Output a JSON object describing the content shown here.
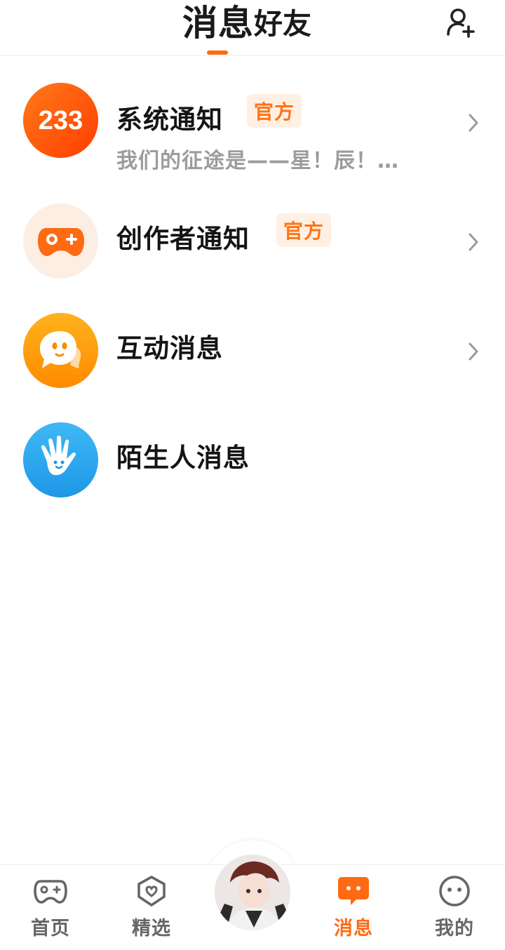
{
  "header": {
    "tabs": [
      {
        "label": "消息",
        "active": true
      },
      {
        "label": "好友",
        "active": false
      }
    ],
    "add_friend_icon": "person-add-icon",
    "accent_color": "#ff6a12"
  },
  "conversations": [
    {
      "title": "系统通知",
      "badge": "官方",
      "subtitle": "我们的征途是——星！辰！…",
      "icon": "233-logo-icon",
      "color": "#ff5a0a",
      "has_chevron": true
    },
    {
      "title": "创作者通知",
      "badge": "官方",
      "subtitle": "",
      "icon": "gamepad-icon",
      "color": "#ff6a12",
      "has_chevron": true
    },
    {
      "title": "互动消息",
      "badge": "",
      "subtitle": "",
      "icon": "chat-bubble-icon",
      "color": "#ff9d10",
      "has_chevron": true
    },
    {
      "title": "陌生人消息",
      "badge": "",
      "subtitle": "",
      "icon": "waving-hand-icon",
      "color": "#2ea9f0",
      "has_chevron": false
    }
  ],
  "bottom_nav": {
    "items": [
      {
        "label": "首页",
        "icon": "gamepad-icon",
        "active": false
      },
      {
        "label": "精选",
        "icon": "heart-badge-icon",
        "active": false
      },
      {
        "label": "",
        "icon": "user-avatar",
        "active": false
      },
      {
        "label": "消息",
        "icon": "message-icon",
        "active": true
      },
      {
        "label": "我的",
        "icon": "smiley-icon",
        "active": false
      }
    ]
  }
}
